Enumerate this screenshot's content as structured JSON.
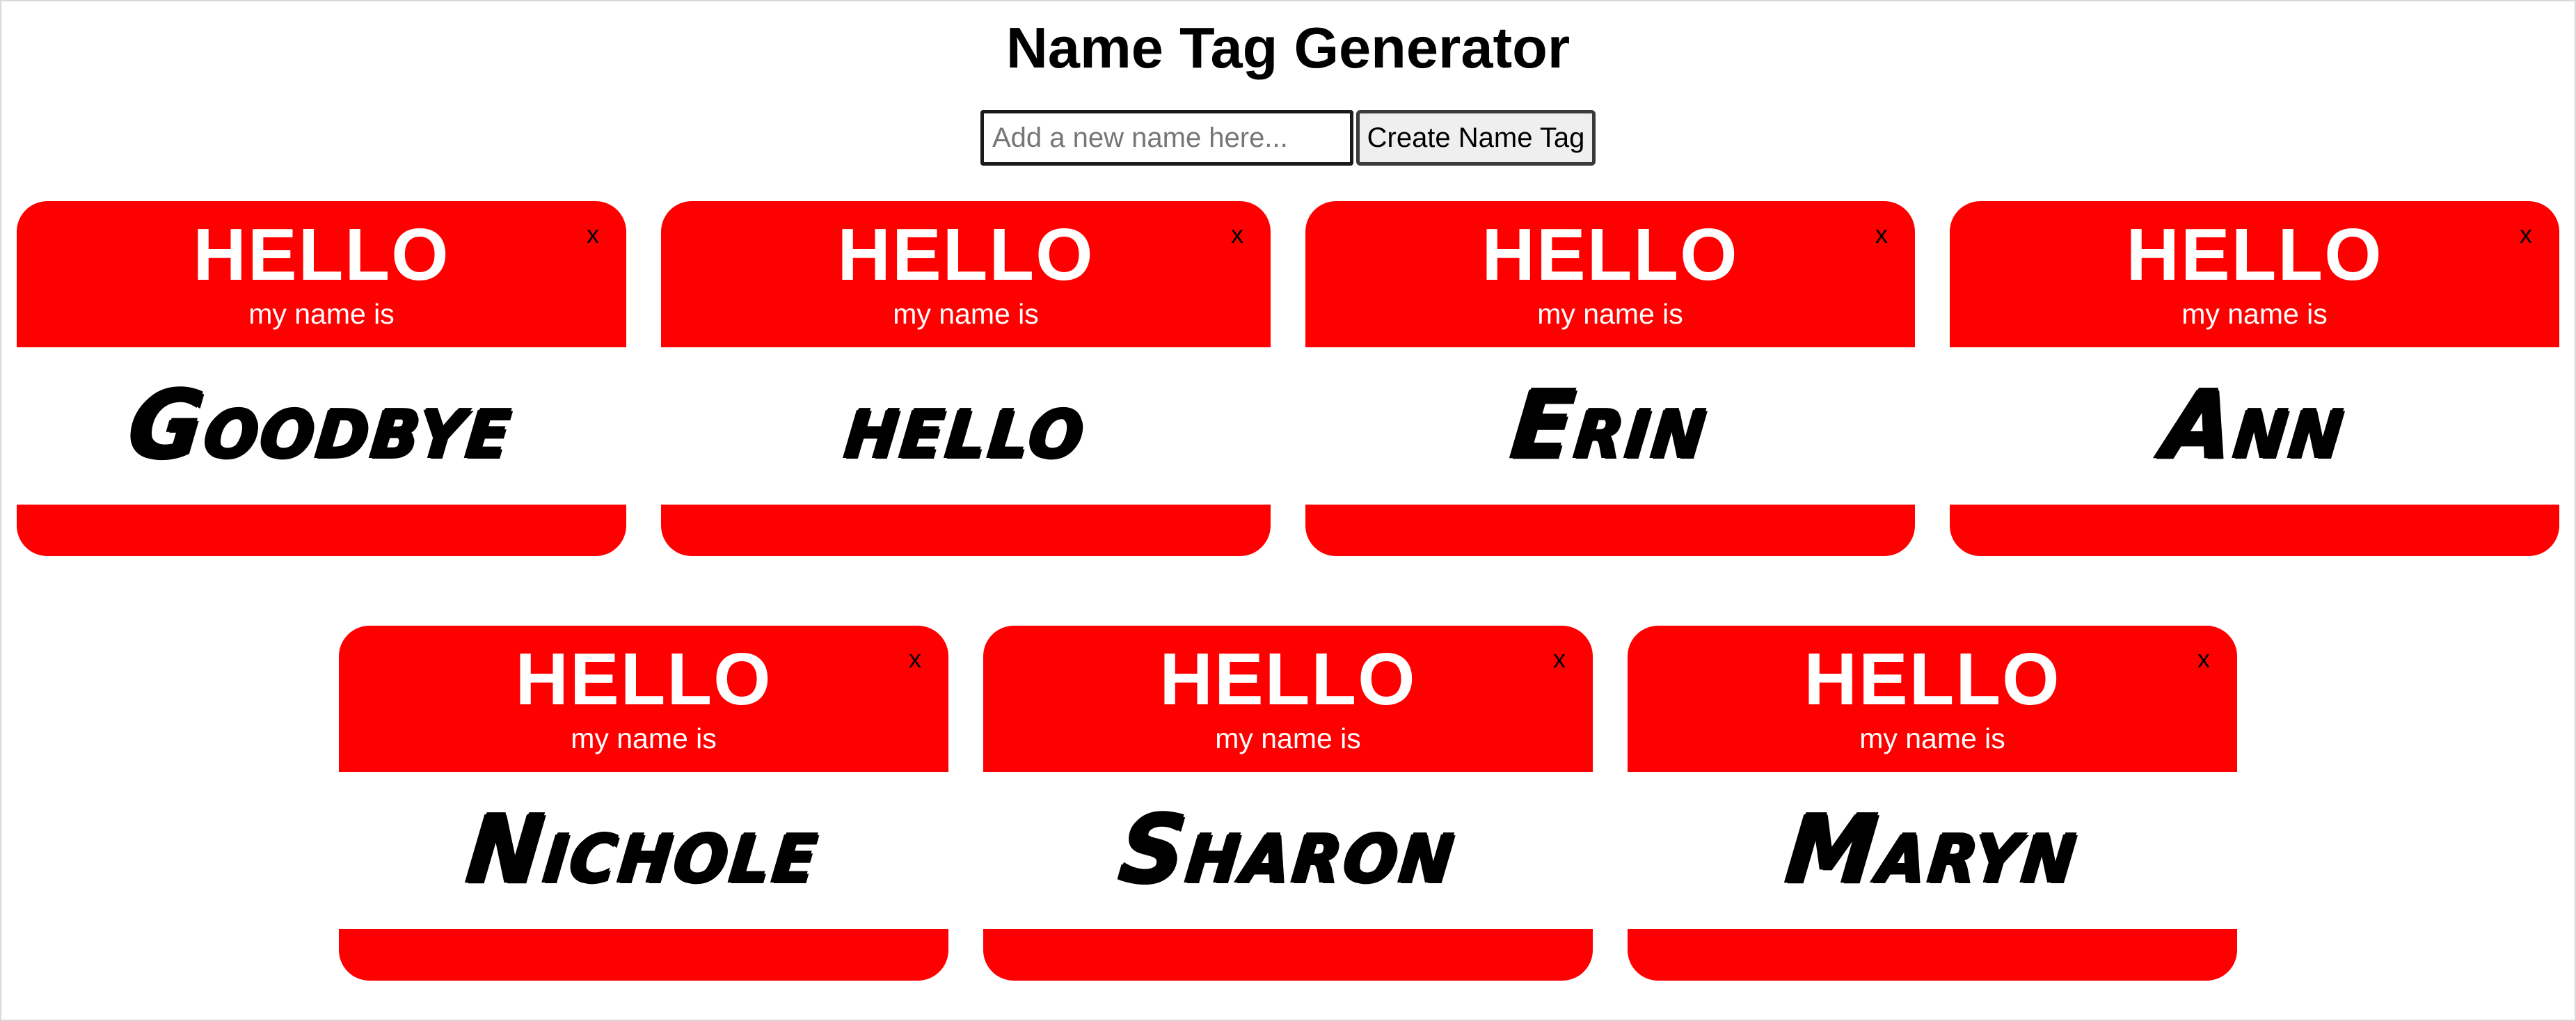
{
  "app": {
    "title": "Name Tag Generator"
  },
  "form": {
    "input_value": "",
    "input_placeholder": "Add a new name here...",
    "button_label": "Create Name Tag"
  },
  "tag_template": {
    "greeting": "HELLO",
    "subtitle": "my name is",
    "remove_label": "x"
  },
  "colors": {
    "tag_red": "#ff0000",
    "tag_text": "#ffffff",
    "name_text": "#000000"
  },
  "tags": [
    {
      "name": "Goodbye"
    },
    {
      "name": "hello"
    },
    {
      "name": "Erin"
    },
    {
      "name": "Ann"
    },
    {
      "name": "Nichole"
    },
    {
      "name": "Sharon"
    },
    {
      "name": "Maryn"
    }
  ]
}
